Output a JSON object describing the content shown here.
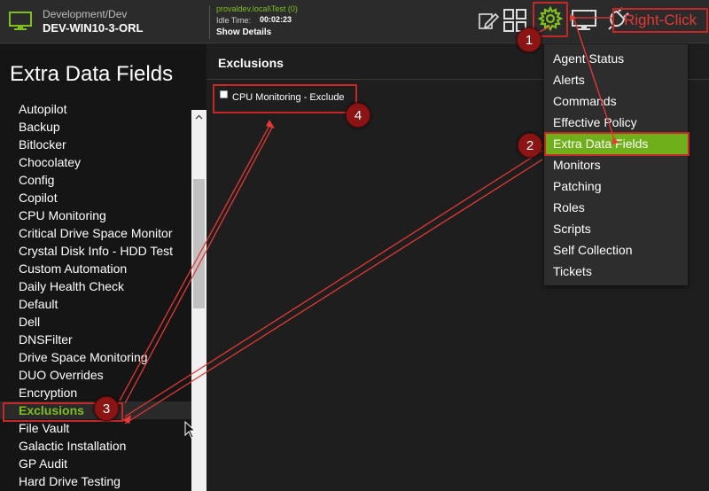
{
  "topbar": {
    "crumb": "Development/Dev",
    "device": "DEV-WIN10-3-ORL",
    "user": "provaldev.local\\Test (0)",
    "idle_label": "Idle Time:",
    "idle_value": "00:02:23",
    "show_details": "Show Details",
    "icons": [
      "monitor-icon",
      "edit-icon",
      "apps-grid-icon",
      "gear-icon",
      "remote-screen-icon",
      "power-plug-icon"
    ],
    "annotation": "Right-Click"
  },
  "sidebar": {
    "title": "Extra Data Fields",
    "items": [
      "Autopilot",
      "Backup",
      "Bitlocker",
      "Chocolatey",
      "Config",
      "Copilot",
      "CPU Monitoring",
      "Critical Drive Space Monitor",
      "Crystal Disk Info - HDD Test",
      "Custom Automation",
      "Daily Health Check",
      "Default",
      "Dell",
      "DNSFilter",
      "Drive Space Monitoring",
      "DUO Overrides",
      "Encryption",
      "Exclusions",
      "File Vault",
      "Galactic Installation",
      "GP Audit",
      "Hard Drive Testing"
    ],
    "active_item": "Exclusions"
  },
  "main": {
    "title": "Exclusions",
    "field_label": "CPU Monitoring - Exclude",
    "field_checked": false
  },
  "menu": {
    "items": [
      "Agent Status",
      "Alerts",
      "Commands",
      "Effective Policy",
      "Extra Data Fields",
      "Monitors",
      "Patching",
      "Roles",
      "Scripts",
      "Self Collection",
      "Tickets"
    ],
    "active": "Extra Data Fields"
  },
  "steps": [
    "1",
    "2",
    "3",
    "4"
  ],
  "colors": {
    "accent_green": "#7fbf1f",
    "annotation_red": "#c62828",
    "badge_red": "#8b1414"
  }
}
